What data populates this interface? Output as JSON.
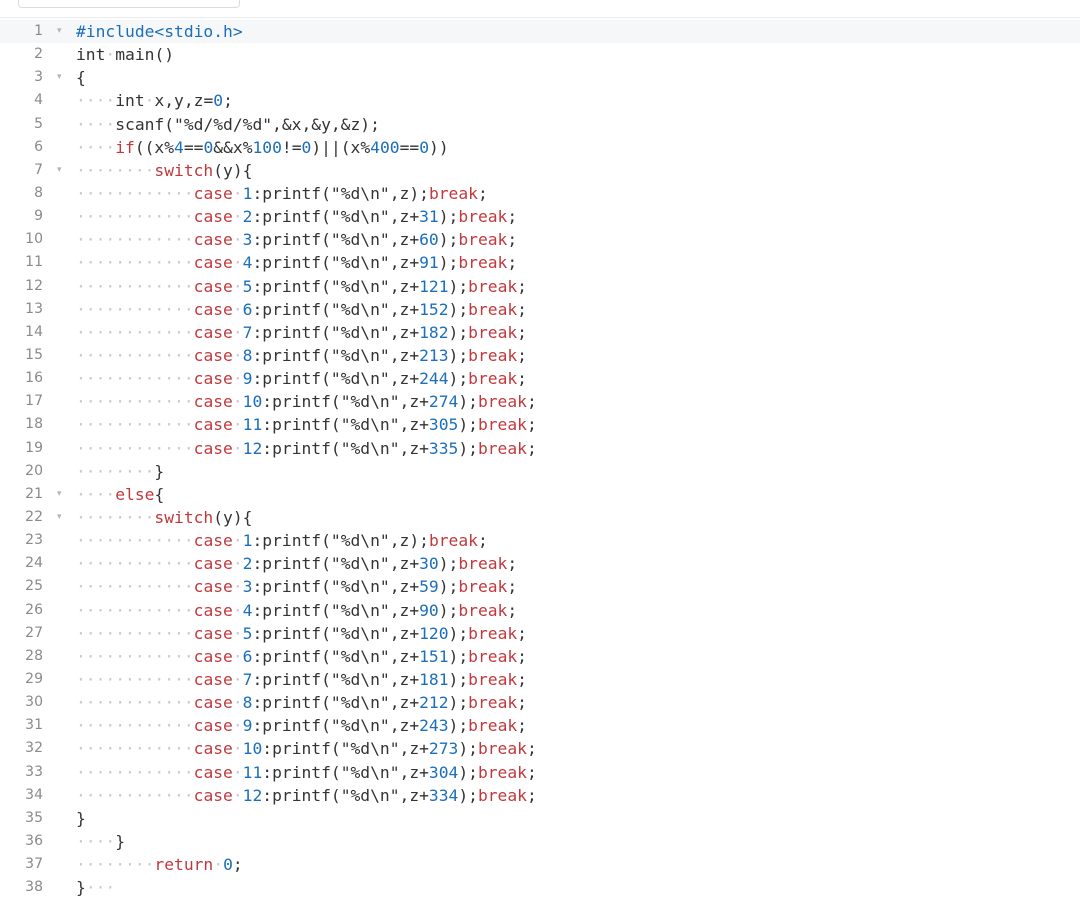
{
  "editor": {
    "language": "c",
    "lines": [
      {
        "n": "1",
        "fold": "▾",
        "hl": true,
        "toks": [
          [
            "pre",
            "#include<stdio.h>"
          ]
        ]
      },
      {
        "n": "2",
        "fold": "",
        "toks": [
          [
            "p",
            "int"
          ],
          [
            "ws",
            "·"
          ],
          [
            "fn",
            "main"
          ],
          [
            "p",
            "()"
          ]
        ]
      },
      {
        "n": "3",
        "fold": "▾",
        "toks": [
          [
            "p",
            "{"
          ]
        ]
      },
      {
        "n": "4",
        "fold": "",
        "toks": [
          [
            "ws",
            "····"
          ],
          [
            "p",
            "int"
          ],
          [
            "ws",
            "·"
          ],
          [
            "p",
            "x,y,z="
          ],
          [
            "num",
            "0"
          ],
          [
            "p",
            ";"
          ]
        ]
      },
      {
        "n": "5",
        "fold": "",
        "toks": [
          [
            "ws",
            "····"
          ],
          [
            "p",
            "scanf(\"%d/%d/%d\",&x,&y,&z);"
          ]
        ]
      },
      {
        "n": "6",
        "fold": "",
        "toks": [
          [
            "ws",
            "····"
          ],
          [
            "kw",
            "if"
          ],
          [
            "p",
            "((x%"
          ],
          [
            "num",
            "4"
          ],
          [
            "p",
            "=="
          ],
          [
            "num",
            "0"
          ],
          [
            "p",
            "&&x%"
          ],
          [
            "num",
            "100"
          ],
          [
            "p",
            "!="
          ],
          [
            "num",
            "0"
          ],
          [
            "p",
            ")||(x%"
          ],
          [
            "num",
            "400"
          ],
          [
            "p",
            "=="
          ],
          [
            "num",
            "0"
          ],
          [
            "p",
            "))"
          ]
        ]
      },
      {
        "n": "7",
        "fold": "▾",
        "toks": [
          [
            "ws",
            "········"
          ],
          [
            "kw",
            "switch"
          ],
          [
            "p",
            "(y){"
          ]
        ]
      },
      {
        "n": "8",
        "fold": "",
        "toks": [
          [
            "ws",
            "············"
          ],
          [
            "kw",
            "case"
          ],
          [
            "ws",
            "·"
          ],
          [
            "num",
            "1"
          ],
          [
            "p",
            ":printf(\"%d\\n\",z);"
          ],
          [
            "kw",
            "break"
          ],
          [
            "p",
            ";"
          ]
        ]
      },
      {
        "n": "9",
        "fold": "",
        "toks": [
          [
            "ws",
            "············"
          ],
          [
            "kw",
            "case"
          ],
          [
            "ws",
            "·"
          ],
          [
            "num",
            "2"
          ],
          [
            "p",
            ":printf(\"%d\\n\",z+"
          ],
          [
            "num",
            "31"
          ],
          [
            "p",
            ");"
          ],
          [
            "kw",
            "break"
          ],
          [
            "p",
            ";"
          ]
        ]
      },
      {
        "n": "10",
        "fold": "",
        "toks": [
          [
            "ws",
            "············"
          ],
          [
            "kw",
            "case"
          ],
          [
            "ws",
            "·"
          ],
          [
            "num",
            "3"
          ],
          [
            "p",
            ":printf(\"%d\\n\",z+"
          ],
          [
            "num",
            "60"
          ],
          [
            "p",
            ");"
          ],
          [
            "kw",
            "break"
          ],
          [
            "p",
            ";"
          ]
        ]
      },
      {
        "n": "11",
        "fold": "",
        "toks": [
          [
            "ws",
            "············"
          ],
          [
            "kw",
            "case"
          ],
          [
            "ws",
            "·"
          ],
          [
            "num",
            "4"
          ],
          [
            "p",
            ":printf(\"%d\\n\",z+"
          ],
          [
            "num",
            "91"
          ],
          [
            "p",
            ");"
          ],
          [
            "kw",
            "break"
          ],
          [
            "p",
            ";"
          ]
        ]
      },
      {
        "n": "12",
        "fold": "",
        "toks": [
          [
            "ws",
            "············"
          ],
          [
            "kw",
            "case"
          ],
          [
            "ws",
            "·"
          ],
          [
            "num",
            "5"
          ],
          [
            "p",
            ":printf(\"%d\\n\",z+"
          ],
          [
            "num",
            "121"
          ],
          [
            "p",
            ");"
          ],
          [
            "kw",
            "break"
          ],
          [
            "p",
            ";"
          ]
        ]
      },
      {
        "n": "13",
        "fold": "",
        "toks": [
          [
            "ws",
            "············"
          ],
          [
            "kw",
            "case"
          ],
          [
            "ws",
            "·"
          ],
          [
            "num",
            "6"
          ],
          [
            "p",
            ":printf(\"%d\\n\",z+"
          ],
          [
            "num",
            "152"
          ],
          [
            "p",
            ");"
          ],
          [
            "kw",
            "break"
          ],
          [
            "p",
            ";"
          ]
        ]
      },
      {
        "n": "14",
        "fold": "",
        "toks": [
          [
            "ws",
            "············"
          ],
          [
            "kw",
            "case"
          ],
          [
            "ws",
            "·"
          ],
          [
            "num",
            "7"
          ],
          [
            "p",
            ":printf(\"%d\\n\",z+"
          ],
          [
            "num",
            "182"
          ],
          [
            "p",
            ");"
          ],
          [
            "kw",
            "break"
          ],
          [
            "p",
            ";"
          ]
        ]
      },
      {
        "n": "15",
        "fold": "",
        "toks": [
          [
            "ws",
            "············"
          ],
          [
            "kw",
            "case"
          ],
          [
            "ws",
            "·"
          ],
          [
            "num",
            "8"
          ],
          [
            "p",
            ":printf(\"%d\\n\",z+"
          ],
          [
            "num",
            "213"
          ],
          [
            "p",
            ");"
          ],
          [
            "kw",
            "break"
          ],
          [
            "p",
            ";"
          ]
        ]
      },
      {
        "n": "16",
        "fold": "",
        "toks": [
          [
            "ws",
            "············"
          ],
          [
            "kw",
            "case"
          ],
          [
            "ws",
            "·"
          ],
          [
            "num",
            "9"
          ],
          [
            "p",
            ":printf(\"%d\\n\",z+"
          ],
          [
            "num",
            "244"
          ],
          [
            "p",
            ");"
          ],
          [
            "kw",
            "break"
          ],
          [
            "p",
            ";"
          ]
        ]
      },
      {
        "n": "17",
        "fold": "",
        "toks": [
          [
            "ws",
            "············"
          ],
          [
            "kw",
            "case"
          ],
          [
            "ws",
            "·"
          ],
          [
            "num",
            "10"
          ],
          [
            "p",
            ":printf(\"%d\\n\",z+"
          ],
          [
            "num",
            "274"
          ],
          [
            "p",
            ");"
          ],
          [
            "kw",
            "break"
          ],
          [
            "p",
            ";"
          ]
        ]
      },
      {
        "n": "18",
        "fold": "",
        "toks": [
          [
            "ws",
            "············"
          ],
          [
            "kw",
            "case"
          ],
          [
            "ws",
            "·"
          ],
          [
            "num",
            "11"
          ],
          [
            "p",
            ":printf(\"%d\\n\",z+"
          ],
          [
            "num",
            "305"
          ],
          [
            "p",
            ");"
          ],
          [
            "kw",
            "break"
          ],
          [
            "p",
            ";"
          ]
        ]
      },
      {
        "n": "19",
        "fold": "",
        "toks": [
          [
            "ws",
            "············"
          ],
          [
            "kw",
            "case"
          ],
          [
            "ws",
            "·"
          ],
          [
            "num",
            "12"
          ],
          [
            "p",
            ":printf(\"%d\\n\",z+"
          ],
          [
            "num",
            "335"
          ],
          [
            "p",
            ");"
          ],
          [
            "kw",
            "break"
          ],
          [
            "p",
            ";"
          ]
        ]
      },
      {
        "n": "20",
        "fold": "",
        "toks": [
          [
            "ws",
            "········"
          ],
          [
            "p",
            "}"
          ]
        ]
      },
      {
        "n": "21",
        "fold": "▾",
        "toks": [
          [
            "ws",
            "····"
          ],
          [
            "kw",
            "else"
          ],
          [
            "p",
            "{"
          ]
        ]
      },
      {
        "n": "22",
        "fold": "▾",
        "toks": [
          [
            "ws",
            "········"
          ],
          [
            "kw",
            "switch"
          ],
          [
            "p",
            "(y){"
          ]
        ]
      },
      {
        "n": "23",
        "fold": "",
        "toks": [
          [
            "ws",
            "············"
          ],
          [
            "kw",
            "case"
          ],
          [
            "ws",
            "·"
          ],
          [
            "num",
            "1"
          ],
          [
            "p",
            ":printf(\"%d\\n\",z);"
          ],
          [
            "kw",
            "break"
          ],
          [
            "p",
            ";"
          ]
        ]
      },
      {
        "n": "24",
        "fold": "",
        "toks": [
          [
            "ws",
            "············"
          ],
          [
            "kw",
            "case"
          ],
          [
            "ws",
            "·"
          ],
          [
            "num",
            "2"
          ],
          [
            "p",
            ":printf(\"%d\\n\",z+"
          ],
          [
            "num",
            "30"
          ],
          [
            "p",
            ");"
          ],
          [
            "kw",
            "break"
          ],
          [
            "p",
            ";"
          ]
        ]
      },
      {
        "n": "25",
        "fold": "",
        "toks": [
          [
            "ws",
            "············"
          ],
          [
            "kw",
            "case"
          ],
          [
            "ws",
            "·"
          ],
          [
            "num",
            "3"
          ],
          [
            "p",
            ":printf(\"%d\\n\",z+"
          ],
          [
            "num",
            "59"
          ],
          [
            "p",
            ");"
          ],
          [
            "kw",
            "break"
          ],
          [
            "p",
            ";"
          ]
        ]
      },
      {
        "n": "26",
        "fold": "",
        "toks": [
          [
            "ws",
            "············"
          ],
          [
            "kw",
            "case"
          ],
          [
            "ws",
            "·"
          ],
          [
            "num",
            "4"
          ],
          [
            "p",
            ":printf(\"%d\\n\",z+"
          ],
          [
            "num",
            "90"
          ],
          [
            "p",
            ");"
          ],
          [
            "kw",
            "break"
          ],
          [
            "p",
            ";"
          ]
        ]
      },
      {
        "n": "27",
        "fold": "",
        "toks": [
          [
            "ws",
            "············"
          ],
          [
            "kw",
            "case"
          ],
          [
            "ws",
            "·"
          ],
          [
            "num",
            "5"
          ],
          [
            "p",
            ":printf(\"%d\\n\",z+"
          ],
          [
            "num",
            "120"
          ],
          [
            "p",
            ");"
          ],
          [
            "kw",
            "break"
          ],
          [
            "p",
            ";"
          ]
        ]
      },
      {
        "n": "28",
        "fold": "",
        "toks": [
          [
            "ws",
            "············"
          ],
          [
            "kw",
            "case"
          ],
          [
            "ws",
            "·"
          ],
          [
            "num",
            "6"
          ],
          [
            "p",
            ":printf(\"%d\\n\",z+"
          ],
          [
            "num",
            "151"
          ],
          [
            "p",
            ");"
          ],
          [
            "kw",
            "break"
          ],
          [
            "p",
            ";"
          ]
        ]
      },
      {
        "n": "29",
        "fold": "",
        "toks": [
          [
            "ws",
            "············"
          ],
          [
            "kw",
            "case"
          ],
          [
            "ws",
            "·"
          ],
          [
            "num",
            "7"
          ],
          [
            "p",
            ":printf(\"%d\\n\",z+"
          ],
          [
            "num",
            "181"
          ],
          [
            "p",
            ");"
          ],
          [
            "kw",
            "break"
          ],
          [
            "p",
            ";"
          ]
        ]
      },
      {
        "n": "30",
        "fold": "",
        "toks": [
          [
            "ws",
            "············"
          ],
          [
            "kw",
            "case"
          ],
          [
            "ws",
            "·"
          ],
          [
            "num",
            "8"
          ],
          [
            "p",
            ":printf(\"%d\\n\",z+"
          ],
          [
            "num",
            "212"
          ],
          [
            "p",
            ");"
          ],
          [
            "kw",
            "break"
          ],
          [
            "p",
            ";"
          ]
        ]
      },
      {
        "n": "31",
        "fold": "",
        "toks": [
          [
            "ws",
            "············"
          ],
          [
            "kw",
            "case"
          ],
          [
            "ws",
            "·"
          ],
          [
            "num",
            "9"
          ],
          [
            "p",
            ":printf(\"%d\\n\",z+"
          ],
          [
            "num",
            "243"
          ],
          [
            "p",
            ");"
          ],
          [
            "kw",
            "break"
          ],
          [
            "p",
            ";"
          ]
        ]
      },
      {
        "n": "32",
        "fold": "",
        "toks": [
          [
            "ws",
            "············"
          ],
          [
            "kw",
            "case"
          ],
          [
            "ws",
            "·"
          ],
          [
            "num",
            "10"
          ],
          [
            "p",
            ":printf(\"%d\\n\",z+"
          ],
          [
            "num",
            "273"
          ],
          [
            "p",
            ");"
          ],
          [
            "kw",
            "break"
          ],
          [
            "p",
            ";"
          ]
        ]
      },
      {
        "n": "33",
        "fold": "",
        "toks": [
          [
            "ws",
            "············"
          ],
          [
            "kw",
            "case"
          ],
          [
            "ws",
            "·"
          ],
          [
            "num",
            "11"
          ],
          [
            "p",
            ":printf(\"%d\\n\",z+"
          ],
          [
            "num",
            "304"
          ],
          [
            "p",
            ");"
          ],
          [
            "kw",
            "break"
          ],
          [
            "p",
            ";"
          ]
        ]
      },
      {
        "n": "34",
        "fold": "",
        "toks": [
          [
            "ws",
            "············"
          ],
          [
            "kw",
            "case"
          ],
          [
            "ws",
            "·"
          ],
          [
            "num",
            "12"
          ],
          [
            "p",
            ":printf(\"%d\\n\",z+"
          ],
          [
            "num",
            "334"
          ],
          [
            "p",
            ");"
          ],
          [
            "kw",
            "break"
          ],
          [
            "p",
            ";"
          ]
        ]
      },
      {
        "n": "35",
        "fold": "",
        "toks": [
          [
            "p",
            "}"
          ]
        ]
      },
      {
        "n": "36",
        "fold": "",
        "toks": [
          [
            "ws",
            "····"
          ],
          [
            "p",
            "}"
          ]
        ]
      },
      {
        "n": "37",
        "fold": "",
        "toks": [
          [
            "ws",
            "········"
          ],
          [
            "kw",
            "return"
          ],
          [
            "ws",
            "·"
          ],
          [
            "num",
            "0"
          ],
          [
            "p",
            ";"
          ]
        ]
      },
      {
        "n": "38",
        "fold": "",
        "toks": [
          [
            "p",
            "}"
          ],
          [
            "ws",
            "···"
          ]
        ]
      }
    ]
  },
  "colors": {
    "keyword": "#c1393d",
    "number": "#1c6fbb",
    "text": "#333333",
    "gutter": "#8a8a8a",
    "whitespace_marker": "#c9c9c9"
  }
}
